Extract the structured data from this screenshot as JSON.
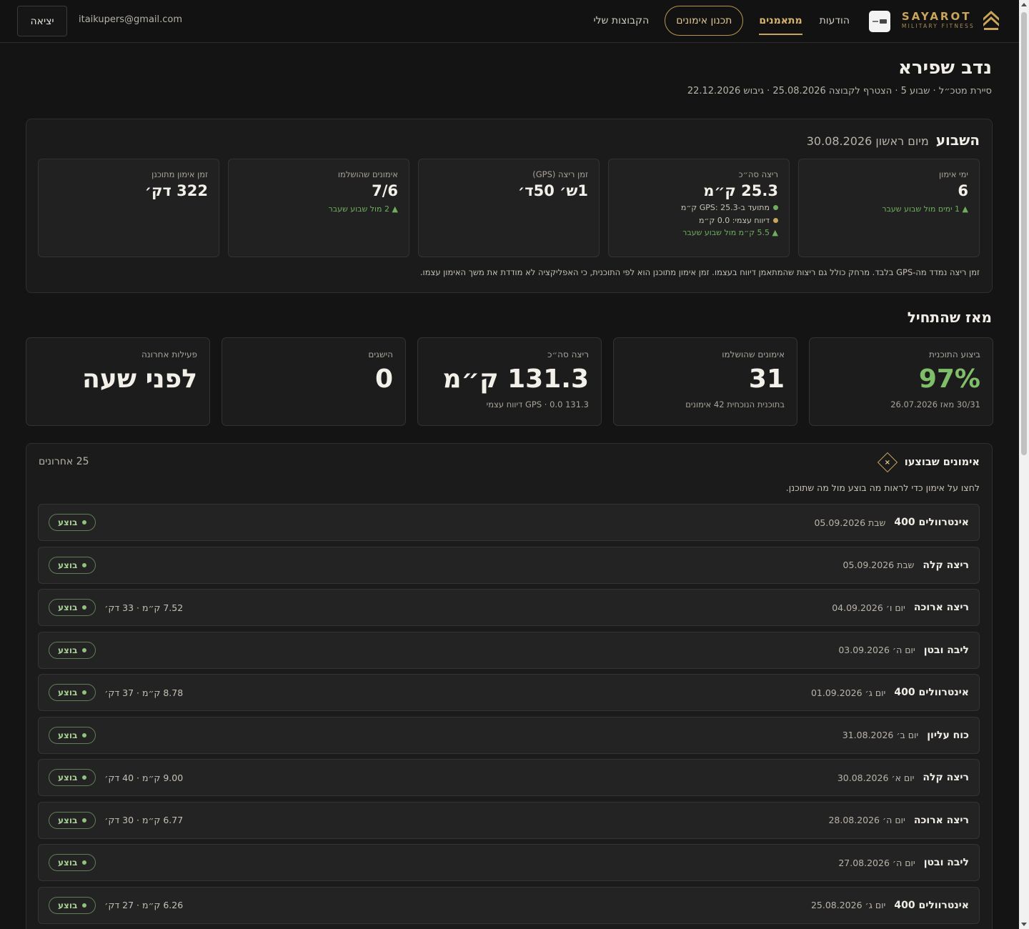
{
  "header": {
    "brand_title": "SAYAROT",
    "brand_sub": "MILITARY FITNESS",
    "nav": {
      "groups": "הקבוצות שלי",
      "plan": "תכנון אימונים",
      "trainees": "מתאמנים",
      "messages": "הודעות"
    },
    "email": "itaikupers@gmail.com",
    "logout": "יציאה"
  },
  "profile": {
    "name": "נדב שפירא",
    "meta": "סיירת מטכ״ל · שבוע 5 · הצטרף לקבוצה 25.08.2026 · גיבוש 22.12.2026"
  },
  "week": {
    "title": "השבוע",
    "subtitle": "מיום ראשון 30.08.2026",
    "cards": [
      {
        "label": "ימי אימון",
        "value": "6",
        "delta": "▲ 1 ימים מול שבוע שעבר"
      },
      {
        "label": "ריצה סה״כ",
        "value": "25.3 ק״מ",
        "detail1": "מתועד ב-GPS: 25.3 ק״מ",
        "detail2": "דיווח עצמי: 0.0 ק״מ",
        "delta": "▲ 5.5 ק״מ מול שבוע שעבר"
      },
      {
        "label": "זמן ריצה (GPS)",
        "value": "1ש׳ 50ד׳"
      },
      {
        "label": "אימונים שהושלמו",
        "value": "7/6",
        "delta": "▲ 2 מול שבוע שעבר"
      },
      {
        "label": "זמן אימון מתוכנן",
        "value": "322 דק׳"
      }
    ],
    "note": "זמן ריצה נמדד מה-GPS בלבד. מרחק כולל גם ריצות שהמתאמן דיווח בעצמו. זמן אימון מתוכנן הוא לפי התוכנית, כי האפליקציה לא מודדת את משך האימון עצמו."
  },
  "since": {
    "title": "מאז שהתחיל",
    "cards": [
      {
        "label": "ביצוע התוכנית",
        "value": "97%",
        "sub": "30/31 מאז 26.07.2026"
      },
      {
        "label": "אימונים שהושלמו",
        "value": "31",
        "sub": "בתוכנית הנוכחית 42 אימונים"
      },
      {
        "label": "ריצה סה״כ",
        "value": "131.3 ק״מ",
        "sub": "131.3 GPS · 0.0 דיווח עצמי"
      },
      {
        "label": "הישגים",
        "value": "0",
        "sub": ""
      },
      {
        "label": "פעילות אחרונה",
        "value": "לפני שעה",
        "sub": ""
      }
    ]
  },
  "workouts": {
    "title": "אימונים שבוצעו",
    "count": "25 אחרונים",
    "hint": "לחצו על אימון כדי לראות מה בוצע מול מה שתוכנן.",
    "badge": "בוצע",
    "rows": [
      {
        "date": "שבת 05.09.2026",
        "name": "אינטרוולים 400",
        "stats": ""
      },
      {
        "date": "שבת 05.09.2026",
        "name": "ריצה קלה",
        "stats": ""
      },
      {
        "date": "יום ו׳ 04.09.2026",
        "name": "ריצה ארוכה",
        "stats": "7.52 ק״מ · 33 דק׳"
      },
      {
        "date": "יום ה׳ 03.09.2026",
        "name": "ליבה ובטן",
        "stats": ""
      },
      {
        "date": "יום ג׳ 01.09.2026",
        "name": "אינטרוולים 400",
        "stats": "8.78 ק״מ · 37 דק׳"
      },
      {
        "date": "יום ב׳ 31.08.2026",
        "name": "כוח עליון",
        "stats": ""
      },
      {
        "date": "יום א׳ 30.08.2026",
        "name": "ריצה קלה",
        "stats": "9.00 ק״מ · 40 דק׳"
      },
      {
        "date": "יום ה׳ 28.08.2026",
        "name": "ריצה ארוכה",
        "stats": "6.77 ק״מ · 30 דק׳"
      },
      {
        "date": "יום ה׳ 27.08.2026",
        "name": "ליבה ובטן",
        "stats": ""
      },
      {
        "date": "יום ג׳ 25.08.2026",
        "name": "אינטרוולים 400",
        "stats": "6.26 ק״מ · 27 דק׳"
      }
    ]
  },
  "colors": {
    "background": "#141414",
    "accent_gold": "#c9a45a",
    "success_green": "#7fbf6a"
  }
}
